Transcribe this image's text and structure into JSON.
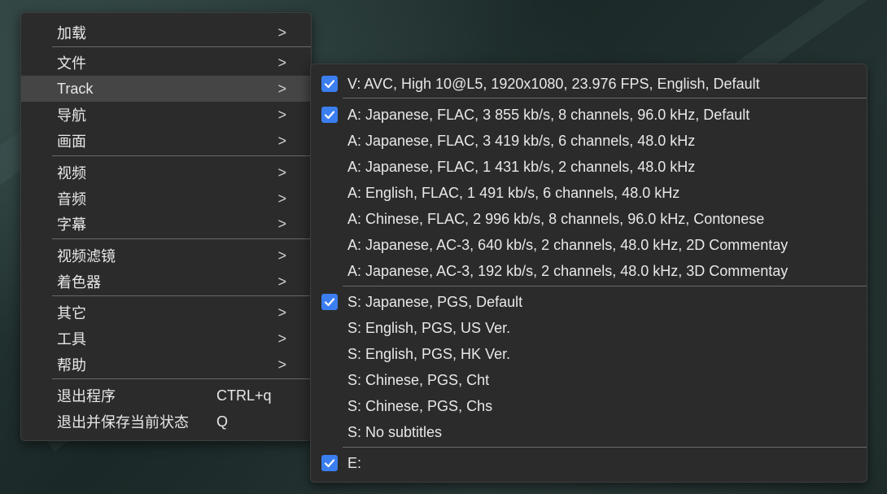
{
  "main_menu": {
    "items": [
      {
        "label": "加载"
      },
      {
        "label": "文件"
      },
      {
        "label": "Track"
      },
      {
        "label": "导航"
      },
      {
        "label": "画面"
      },
      {
        "label": "视频"
      },
      {
        "label": "音频"
      },
      {
        "label": "字幕"
      },
      {
        "label": "视频滤镜"
      },
      {
        "label": "着色器"
      },
      {
        "label": "其它"
      },
      {
        "label": "工具"
      },
      {
        "label": "帮助"
      },
      {
        "label": "退出程序",
        "shortcut": "CTRL+q"
      },
      {
        "label": "退出并保存当前状态",
        "shortcut": "Q"
      }
    ],
    "chevron": ">",
    "active_item": "Track"
  },
  "track_menu": {
    "video": [
      {
        "label": "V: AVC, High 10@L5, 1920x1080, 23.976 FPS, English, Default",
        "checked": true
      }
    ],
    "audio": [
      {
        "label": "A: Japanese, FLAC, 3 855 kb/s, 8 channels, 96.0 kHz, Default",
        "checked": true
      },
      {
        "label": "A: Japanese, FLAC, 3 419 kb/s, 6 channels, 48.0 kHz",
        "checked": false
      },
      {
        "label": "A: Japanese, FLAC, 1 431 kb/s, 2 channels, 48.0 kHz",
        "checked": false
      },
      {
        "label": "A: English, FLAC, 1 491 kb/s, 6 channels, 48.0 kHz",
        "checked": false
      },
      {
        "label": "A: Chinese, FLAC, 2 996 kb/s, 8 channels, 96.0 kHz, Contonese",
        "checked": false
      },
      {
        "label": "A: Japanese, AC-3, 640 kb/s, 2 channels, 48.0 kHz, 2D Commentay",
        "checked": false
      },
      {
        "label": "A: Japanese, AC-3, 192 kb/s, 2 channels, 48.0 kHz, 3D Commentay",
        "checked": false
      }
    ],
    "subtitles": [
      {
        "label": "S: Japanese, PGS, Default",
        "checked": true
      },
      {
        "label": "S: English, PGS, US Ver.",
        "checked": false
      },
      {
        "label": "S: English, PGS, HK Ver.",
        "checked": false
      },
      {
        "label": "S: Chinese, PGS, Cht",
        "checked": false
      },
      {
        "label": "S: Chinese, PGS, Chs",
        "checked": false
      },
      {
        "label": "S: No subtitles",
        "checked": false
      }
    ],
    "edition": [
      {
        "label": "E:",
        "checked": true
      }
    ]
  },
  "colors": {
    "menu_bg": "#2b2b2b",
    "active_bg": "#454545",
    "check_accent": "#3b7ef0",
    "text": "#e8e8e8"
  },
  "icons": {
    "chevron": "chevron-right-icon",
    "check": "checkbox-checked-icon"
  }
}
